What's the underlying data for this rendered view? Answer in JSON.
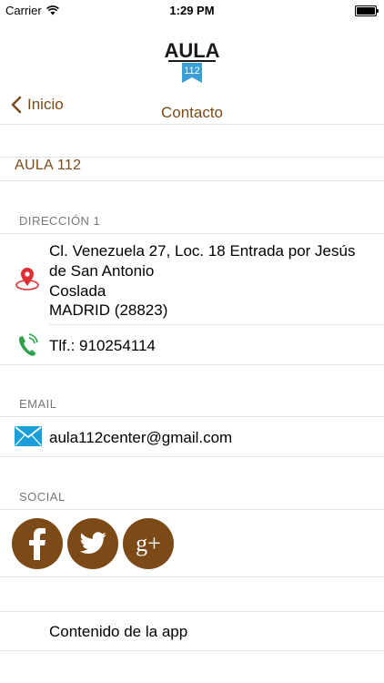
{
  "status_bar": {
    "carrier": "Carrier",
    "time": "1:29 PM"
  },
  "header": {
    "logo_text": "AULA",
    "logo_number": "112",
    "back_label": "Inicio",
    "title": "Contacto"
  },
  "business": {
    "name": "AULA 112"
  },
  "address_section": {
    "label": "DIRECCIÓN 1",
    "line1": "Cl. Venezuela 27, Loc. 18 Entrada por Jesús",
    "line2": "de San Antonio",
    "line3": "Coslada",
    "line4": "MADRID (28823)",
    "phone": "Tlf.: 910254114"
  },
  "email_section": {
    "label": "EMAIL",
    "email": "aula112center@gmail.com"
  },
  "social_section": {
    "label": "SOCIAL",
    "buttons": [
      "facebook-icon",
      "twitter-icon",
      "google-plus-icon"
    ],
    "google_plus_glyph": "g+"
  },
  "footer": {
    "app_content_label": "Contenido de la app"
  },
  "colors": {
    "accent": "#7a4a17",
    "social_bg": "#7b4a17",
    "pin_red": "#e02f33",
    "phone_green": "#2ca14a",
    "email_blue": "#1a9fd9"
  }
}
